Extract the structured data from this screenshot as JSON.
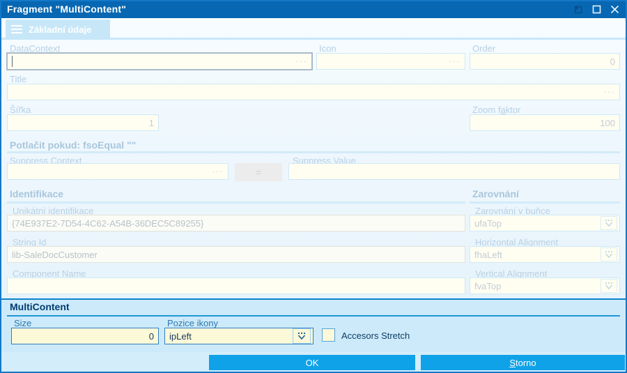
{
  "window": {
    "title": "Fragment \"MultiContent\""
  },
  "tab": {
    "label": "Základní údaje"
  },
  "icons": {
    "ellipsis": "...",
    "equals": "="
  },
  "general": {
    "datacontext": {
      "label": "&DataContext",
      "value": ""
    },
    "icon": {
      "label": "Icon",
      "value": ""
    },
    "order": {
      "label": "Order",
      "value": "0"
    },
    "title": {
      "label": "Title",
      "value": ""
    },
    "sirka": {
      "label": "Šířka",
      "value": "1"
    },
    "zoom_faktor": {
      "label": "Zoom f&aktor",
      "value": "100"
    },
    "suppress_header": "Potlačit pokud:  fsoEqual \"\"",
    "suppress_context": {
      "label": "Suppress Context",
      "value": ""
    },
    "suppress_value": {
      "label": "Suppress Value",
      "value": ""
    }
  },
  "identifikace": {
    "header": "Identifikace",
    "unique_id": {
      "label": "Unikátní identifikace",
      "value": "{74E937E2-7D54-4C62-A54B-36DEC5C89255}"
    },
    "string_id": {
      "label": "String Id",
      "value": "lib-SaleDocCustomer"
    },
    "component_name": {
      "label": "Component Name",
      "value": ""
    }
  },
  "zarovnani": {
    "header": "Zarovnání",
    "cell_alignment": {
      "label": "&Zarovnání v buňce",
      "value": "ufaTop"
    },
    "horizontal_alignment": {
      "label": "Horizontal Alignment",
      "value": "fhaLeft"
    },
    "vertical_alignment": {
      "label": "Vertical Alignment",
      "value": "fvaTop"
    }
  },
  "multicontent": {
    "header": "MultiContent",
    "size": {
      "label": "Size",
      "value": "0"
    },
    "pozice_ikony": {
      "label": "Pozice ikony",
      "value": "ipLeft"
    },
    "accesors_stretch": {
      "label": "Accesors Stretch",
      "checked": false
    }
  },
  "buttons": {
    "ok": "OK",
    "storno": "&Storno"
  },
  "colors": {
    "titlebar": "#0767b2",
    "accent": "#0fa2e8",
    "panel": "#cdeafa",
    "field_bg": "#fcf9d9"
  }
}
